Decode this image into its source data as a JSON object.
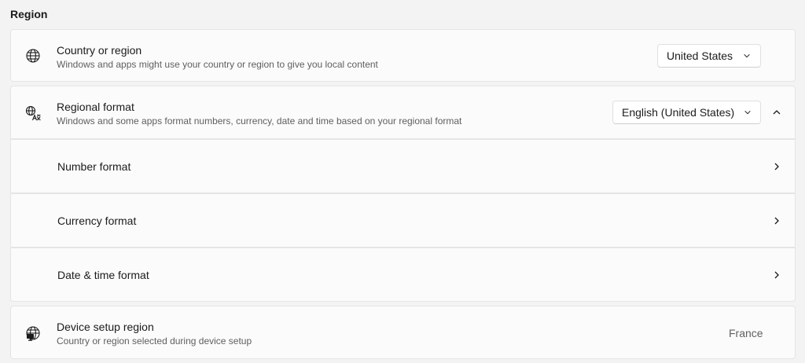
{
  "section": {
    "title": "Region"
  },
  "country": {
    "title": "Country or region",
    "description": "Windows and apps might use your country or region to give you local content",
    "selected": "United States",
    "icon": "globe-icon"
  },
  "regional_format": {
    "title": "Regional format",
    "description": "Windows and some apps format numbers, currency, date and time based on your regional format",
    "selected": "English (United States)",
    "icon": "language-icon",
    "expanded": true
  },
  "sub_items": [
    {
      "label": "Number format"
    },
    {
      "label": "Currency format"
    },
    {
      "label": "Date & time format"
    }
  ],
  "device_setup": {
    "title": "Device setup region",
    "description": "Country or region selected during device setup",
    "value": "France",
    "icon": "globe-monitor-icon"
  },
  "colors": {
    "background": "#f3f3f3",
    "card": "#fbfbfb",
    "border": "#e5e5e5",
    "text_primary": "#1b1b1b",
    "text_secondary": "#5f5f5f"
  }
}
